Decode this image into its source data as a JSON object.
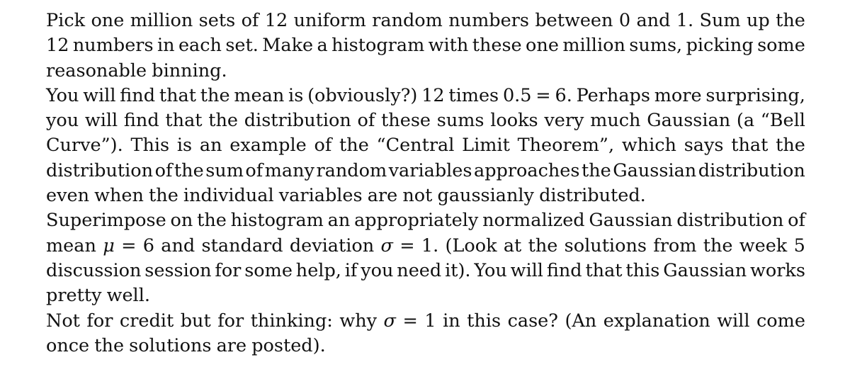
{
  "document": {
    "paragraphs": [
      {
        "lines": [
          "Pick one million sets of 12 uniform random numbers between 0 and 1. Sum up the",
          "12 numbers in each set. Make a histogram with these one million sums, picking some",
          "reasonable binning."
        ]
      },
      {
        "lines": [
          "You will find that the mean is (obviously?) 12 times 0.5 = 6. Perhaps more surprising,",
          "you will find that the distribution of these sums looks very much Gaussian (a “Bell",
          "Curve”). This is an example of the “Central Limit Theorem”, which says that the",
          "distribution of the sum of many random variables approaches the Gaussian distribution",
          "even when the individual variables are not gaussianly distributed."
        ]
      },
      {
        "lines": [
          "Superimpose on the histogram an appropriately normalized Gaussian distribution of",
          "mean μ = 6 and standard deviation σ = 1. (Look at the solutions from the week 5",
          "discussion session for some help, if you need it). You will find that this Gaussian works",
          "pretty well."
        ]
      },
      {
        "lines": [
          "Not for credit but for thinking: why σ = 1 in this case? (An explanation will come",
          "once the solutions are posted)."
        ]
      }
    ]
  }
}
